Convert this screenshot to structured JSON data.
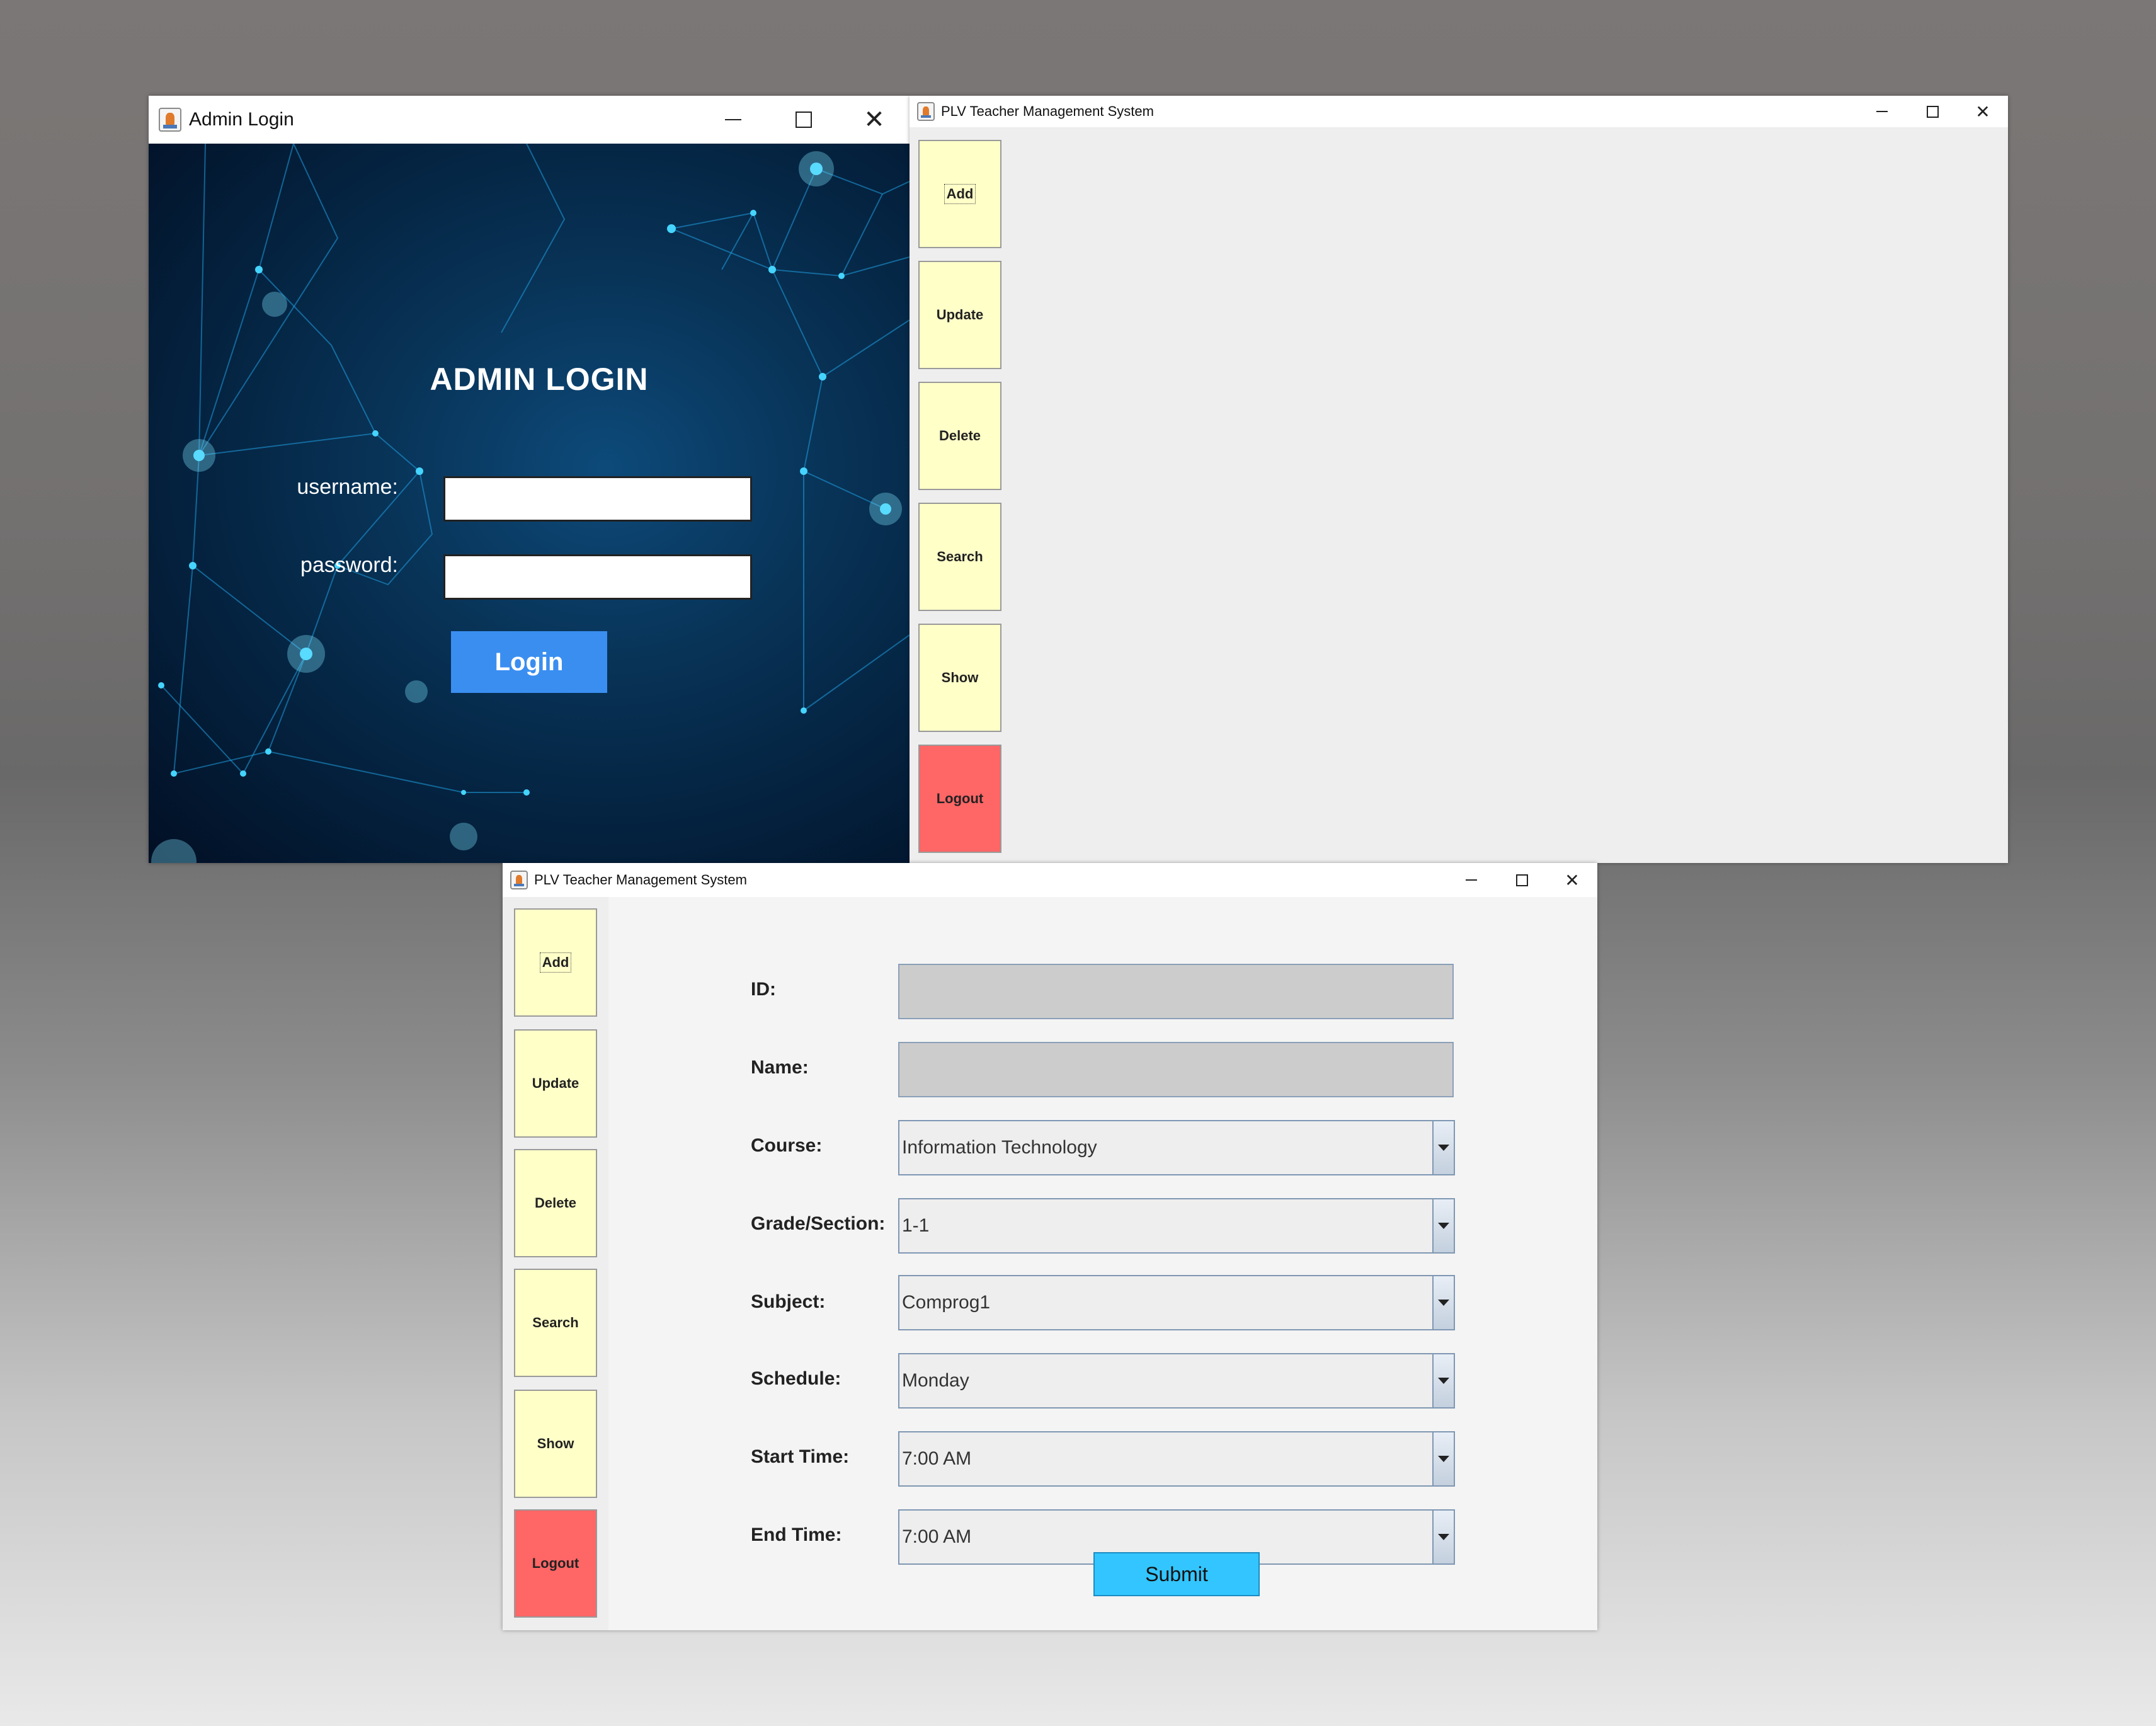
{
  "login_window": {
    "title": "Admin Login",
    "heading": "ADMIN LOGIN",
    "username_label": "username:",
    "password_label": "password:",
    "username_value": "",
    "password_value": "",
    "login_label": "Login"
  },
  "main_window": {
    "title": "PLV Teacher Management System",
    "sidebar": [
      {
        "label": "Add"
      },
      {
        "label": "Update"
      },
      {
        "label": "Delete"
      },
      {
        "label": "Search"
      },
      {
        "label": "Show"
      },
      {
        "label": "Logout"
      }
    ]
  },
  "form_window": {
    "title": "PLV Teacher Management System",
    "sidebar": [
      {
        "label": "Add"
      },
      {
        "label": "Update"
      },
      {
        "label": "Delete"
      },
      {
        "label": "Search"
      },
      {
        "label": "Show"
      },
      {
        "label": "Logout"
      }
    ],
    "fields": {
      "id_label": "ID:",
      "name_label": "Name:",
      "course_label": "Course:",
      "course_value": "Information Technology",
      "grade_label": "Grade/Section:",
      "grade_value": "1-1",
      "subject_label": "Subject:",
      "subject_value": "Comprog1",
      "schedule_label": "Schedule:",
      "schedule_value": "Monday",
      "start_label": "Start Time:",
      "start_value": "7:00 AM",
      "end_label": "End Time:",
      "end_value": "7:00 AM"
    },
    "submit_label": "Submit"
  },
  "colors": {
    "sidebar_button": "#ffffc8",
    "logout_button": "#ff6666",
    "login_button": "#3a8ef0",
    "submit_button": "#33c5ff"
  }
}
